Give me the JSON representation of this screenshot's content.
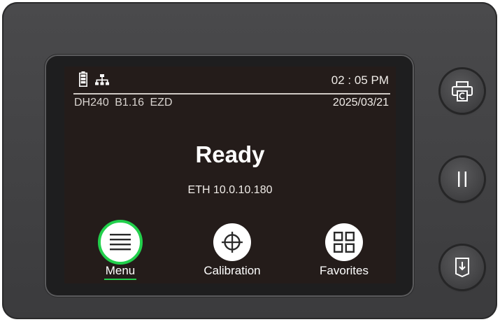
{
  "status_bar": {
    "time": "02 : 05 PM",
    "model_info": "DH240  B1.16  EZD",
    "date": "2025/03/21",
    "battery_icon": "battery-full-icon",
    "network_icon": "network-icon"
  },
  "main": {
    "status_title": "Ready",
    "ip_address": "ETH 10.0.10.180"
  },
  "nav": {
    "items": [
      {
        "label": "Menu",
        "icon": "hamburger-menu-icon",
        "active": true
      },
      {
        "label": "Calibration",
        "icon": "crosshair-icon",
        "active": false
      },
      {
        "label": "Favorites",
        "icon": "grid-icon",
        "active": false
      }
    ]
  },
  "hardware_buttons": [
    {
      "icon": "print-copy-icon"
    },
    {
      "icon": "pause-icon"
    },
    {
      "icon": "feed-icon"
    }
  ],
  "colors": {
    "screen_bg": "#241c1a",
    "accent": "#22d04c",
    "device_body": "#3f3f41"
  }
}
